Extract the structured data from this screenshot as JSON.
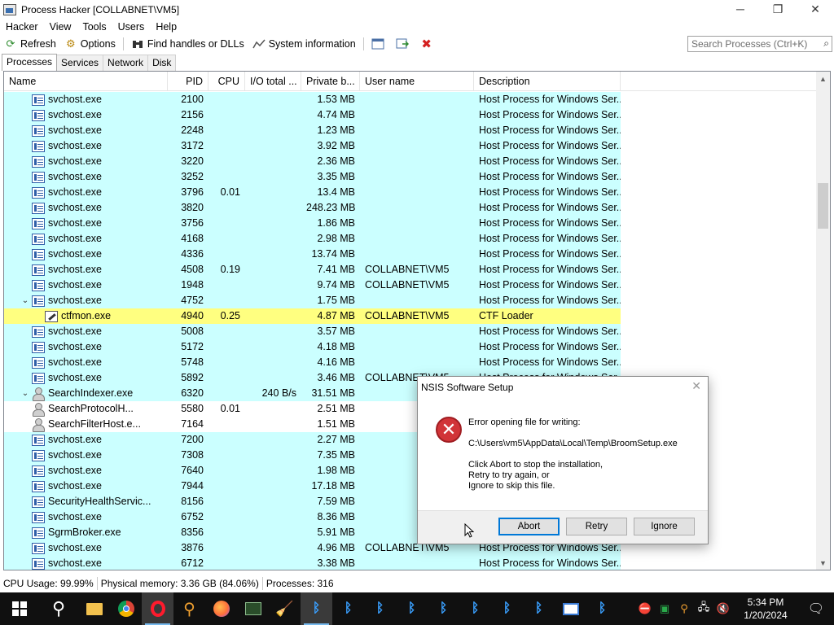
{
  "window": {
    "title": "Process Hacker [COLLABNET\\VM5]",
    "controls": [
      "─",
      "❐",
      "✕"
    ]
  },
  "menu": [
    "Hacker",
    "View",
    "Tools",
    "Users",
    "Help"
  ],
  "toolbar": {
    "refresh": "Refresh",
    "options": "Options",
    "find": "Find handles or DLLs",
    "sysinfo": "System information",
    "search_placeholder": "Search Processes (Ctrl+K)"
  },
  "tabs": [
    "Processes",
    "Services",
    "Network",
    "Disk"
  ],
  "columns": [
    "Name",
    "PID",
    "CPU",
    "I/O total ...",
    "Private b...",
    "User name",
    "Description"
  ],
  "rows": [
    {
      "indent": 1,
      "expander": "",
      "icon": "svc",
      "name": "svchost.exe",
      "pid": "2100",
      "cpu": "",
      "io": "",
      "priv": "1.53 MB",
      "user": "",
      "desc": "Host Process for Windows Ser...",
      "style": "svc"
    },
    {
      "indent": 1,
      "expander": "",
      "icon": "svc",
      "name": "svchost.exe",
      "pid": "2156",
      "cpu": "",
      "io": "",
      "priv": "4.74 MB",
      "user": "",
      "desc": "Host Process for Windows Ser...",
      "style": "svc"
    },
    {
      "indent": 1,
      "expander": "",
      "icon": "svc",
      "name": "svchost.exe",
      "pid": "2248",
      "cpu": "",
      "io": "",
      "priv": "1.23 MB",
      "user": "",
      "desc": "Host Process for Windows Ser...",
      "style": "svc"
    },
    {
      "indent": 1,
      "expander": "",
      "icon": "svc",
      "name": "svchost.exe",
      "pid": "3172",
      "cpu": "",
      "io": "",
      "priv": "3.92 MB",
      "user": "",
      "desc": "Host Process for Windows Ser...",
      "style": "svc"
    },
    {
      "indent": 1,
      "expander": "",
      "icon": "svc",
      "name": "svchost.exe",
      "pid": "3220",
      "cpu": "",
      "io": "",
      "priv": "2.36 MB",
      "user": "",
      "desc": "Host Process for Windows Ser...",
      "style": "svc"
    },
    {
      "indent": 1,
      "expander": "",
      "icon": "svc",
      "name": "svchost.exe",
      "pid": "3252",
      "cpu": "",
      "io": "",
      "priv": "3.35 MB",
      "user": "",
      "desc": "Host Process for Windows Ser...",
      "style": "svc"
    },
    {
      "indent": 1,
      "expander": "",
      "icon": "svc",
      "name": "svchost.exe",
      "pid": "3796",
      "cpu": "0.01",
      "io": "",
      "priv": "13.4 MB",
      "user": "",
      "desc": "Host Process for Windows Ser...",
      "style": "svc"
    },
    {
      "indent": 1,
      "expander": "",
      "icon": "svc",
      "name": "svchost.exe",
      "pid": "3820",
      "cpu": "",
      "io": "",
      "priv": "248.23 MB",
      "user": "",
      "desc": "Host Process for Windows Ser...",
      "style": "svc"
    },
    {
      "indent": 1,
      "expander": "",
      "icon": "svc",
      "name": "svchost.exe",
      "pid": "3756",
      "cpu": "",
      "io": "",
      "priv": "1.86 MB",
      "user": "",
      "desc": "Host Process for Windows Ser...",
      "style": "svc"
    },
    {
      "indent": 1,
      "expander": "",
      "icon": "svc",
      "name": "svchost.exe",
      "pid": "4168",
      "cpu": "",
      "io": "",
      "priv": "2.98 MB",
      "user": "",
      "desc": "Host Process for Windows Ser...",
      "style": "svc"
    },
    {
      "indent": 1,
      "expander": "",
      "icon": "svc",
      "name": "svchost.exe",
      "pid": "4336",
      "cpu": "",
      "io": "",
      "priv": "13.74 MB",
      "user": "",
      "desc": "Host Process for Windows Ser...",
      "style": "svc"
    },
    {
      "indent": 1,
      "expander": "",
      "icon": "svc",
      "name": "svchost.exe",
      "pid": "4508",
      "cpu": "0.19",
      "io": "",
      "priv": "7.41 MB",
      "user": "COLLABNET\\VM5",
      "desc": "Host Process for Windows Ser...",
      "style": "svc"
    },
    {
      "indent": 1,
      "expander": "",
      "icon": "svc",
      "name": "svchost.exe",
      "pid": "1948",
      "cpu": "",
      "io": "",
      "priv": "9.74 MB",
      "user": "COLLABNET\\VM5",
      "desc": "Host Process for Windows Ser...",
      "style": "svc"
    },
    {
      "indent": 1,
      "expander": "⌄",
      "icon": "svc",
      "name": "svchost.exe",
      "pid": "4752",
      "cpu": "",
      "io": "",
      "priv": "1.75 MB",
      "user": "",
      "desc": "Host Process for Windows Ser...",
      "style": "svc"
    },
    {
      "indent": 2,
      "expander": "",
      "icon": "pencil",
      "name": "ctfmon.exe",
      "pid": "4940",
      "cpu": "0.25",
      "io": "",
      "priv": "4.87 MB",
      "user": "COLLABNET\\VM5",
      "desc": "CTF Loader",
      "style": "highlight"
    },
    {
      "indent": 1,
      "expander": "",
      "icon": "svc",
      "name": "svchost.exe",
      "pid": "5008",
      "cpu": "",
      "io": "",
      "priv": "3.57 MB",
      "user": "",
      "desc": "Host Process for Windows Ser...",
      "style": "svc"
    },
    {
      "indent": 1,
      "expander": "",
      "icon": "svc",
      "name": "svchost.exe",
      "pid": "5172",
      "cpu": "",
      "io": "",
      "priv": "4.18 MB",
      "user": "",
      "desc": "Host Process for Windows Ser...",
      "style": "svc"
    },
    {
      "indent": 1,
      "expander": "",
      "icon": "svc",
      "name": "svchost.exe",
      "pid": "5748",
      "cpu": "",
      "io": "",
      "priv": "4.16 MB",
      "user": "",
      "desc": "Host Process for Windows Ser...",
      "style": "svc"
    },
    {
      "indent": 1,
      "expander": "",
      "icon": "svc",
      "name": "svchost.exe",
      "pid": "5892",
      "cpu": "",
      "io": "",
      "priv": "3.46 MB",
      "user": "COLLABNET\\VM5",
      "desc": "Host Process for Windows Ser...",
      "style": "svc"
    },
    {
      "indent": 0,
      "expander": "⌄",
      "icon": "person",
      "name": "SearchIndexer.exe",
      "pid": "6320",
      "cpu": "",
      "io": "240 B/s",
      "priv": "31.51 MB",
      "user": "",
      "desc": "",
      "style": "svc"
    },
    {
      "indent": 1,
      "expander": "",
      "icon": "person",
      "name": "SearchProtocolH...",
      "pid": "5580",
      "cpu": "0.01",
      "io": "",
      "priv": "2.51 MB",
      "user": "",
      "desc": "",
      "style": "plain"
    },
    {
      "indent": 1,
      "expander": "",
      "icon": "person",
      "name": "SearchFilterHost.e...",
      "pid": "7164",
      "cpu": "",
      "io": "",
      "priv": "1.51 MB",
      "user": "",
      "desc": "",
      "style": "plain"
    },
    {
      "indent": 1,
      "expander": "",
      "icon": "svc",
      "name": "svchost.exe",
      "pid": "7200",
      "cpu": "",
      "io": "",
      "priv": "2.27 MB",
      "user": "",
      "desc": "",
      "style": "svc"
    },
    {
      "indent": 1,
      "expander": "",
      "icon": "svc",
      "name": "svchost.exe",
      "pid": "7308",
      "cpu": "",
      "io": "",
      "priv": "7.35 MB",
      "user": "",
      "desc": "",
      "style": "svc"
    },
    {
      "indent": 1,
      "expander": "",
      "icon": "svc",
      "name": "svchost.exe",
      "pid": "7640",
      "cpu": "",
      "io": "",
      "priv": "1.98 MB",
      "user": "",
      "desc": "",
      "style": "svc"
    },
    {
      "indent": 1,
      "expander": "",
      "icon": "svc",
      "name": "svchost.exe",
      "pid": "7944",
      "cpu": "",
      "io": "",
      "priv": "17.18 MB",
      "user": "",
      "desc": "",
      "style": "svc"
    },
    {
      "indent": 1,
      "expander": "",
      "icon": "svc",
      "name": "SecurityHealthServic...",
      "pid": "8156",
      "cpu": "",
      "io": "",
      "priv": "7.59 MB",
      "user": "",
      "desc": "",
      "style": "svc"
    },
    {
      "indent": 1,
      "expander": "",
      "icon": "svc",
      "name": "svchost.exe",
      "pid": "6752",
      "cpu": "",
      "io": "",
      "priv": "8.36 MB",
      "user": "",
      "desc": "",
      "style": "svc"
    },
    {
      "indent": 1,
      "expander": "",
      "icon": "svc",
      "name": "SgrmBroker.exe",
      "pid": "8356",
      "cpu": "",
      "io": "",
      "priv": "5.91 MB",
      "user": "",
      "desc": "",
      "style": "svc"
    },
    {
      "indent": 1,
      "expander": "",
      "icon": "svc",
      "name": "svchost.exe",
      "pid": "3876",
      "cpu": "",
      "io": "",
      "priv": "4.96 MB",
      "user": "COLLABNET\\VM5",
      "desc": "Host Process for Windows Ser...",
      "style": "svc"
    },
    {
      "indent": 1,
      "expander": "",
      "icon": "svc",
      "name": "svchost.exe",
      "pid": "6712",
      "cpu": "",
      "io": "",
      "priv": "3.38 MB",
      "user": "",
      "desc": "Host Process for Windows Ser...",
      "style": "svc"
    }
  ],
  "status": {
    "cpu": "CPU Usage: 99.99%",
    "memory": "Physical memory: 3.36 GB (84.06%)",
    "processes": "Processes: 316"
  },
  "dialog": {
    "title": "NSIS Software Setup",
    "close": "✕",
    "line1": "Error opening file for writing:",
    "path": "C:\\Users\\vm5\\AppData\\Local\\Temp\\BroomSetup.exe",
    "message": "Click Abort to stop the installation,\nRetry to try again, or\nIgnore to skip this file.",
    "abort": "Abort",
    "retry": "Retry",
    "ignore": "Ignore"
  },
  "taskbar": {
    "time": "5:34 PM",
    "date": "1/20/2024"
  },
  "colors": {
    "service_row": "#cbffff",
    "highlight_row": "#ffff80",
    "taskbar": "#101010",
    "error_red": "#d13438"
  }
}
